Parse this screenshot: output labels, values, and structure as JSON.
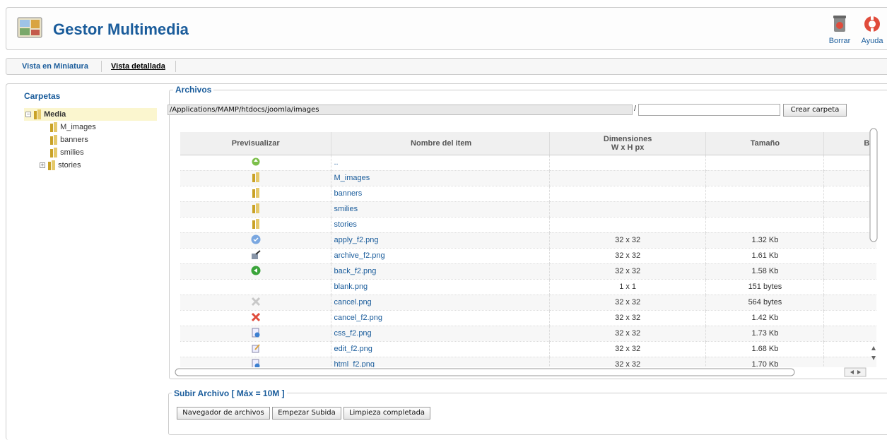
{
  "header": {
    "title": "Gestor Multimedia",
    "logo_icon": "media-manager-icon",
    "buttons": [
      {
        "label": "Borrar",
        "icon": "trash-icon"
      },
      {
        "label": "Ayuda",
        "icon": "help-lifebuoy-icon"
      }
    ]
  },
  "tabs": [
    {
      "label": "Vista en Miniatura",
      "active": false
    },
    {
      "label": "Vista detallada",
      "active": true
    }
  ],
  "sidebar": {
    "title": "Carpetas",
    "root": "Media",
    "items": [
      "M_images",
      "banners",
      "smilies",
      "stories"
    ]
  },
  "files": {
    "legend": "Archivos",
    "path": "/Applications/MAMP/htdocs/joomla/images",
    "separator": "/",
    "folder_input": "",
    "create_folder_label": "Crear carpeta",
    "columns": {
      "preview": "Previsualizar",
      "name": "Nombre del item",
      "dimensions": "Dimensiones",
      "dimensions_sub": "W x H px",
      "size": "Tamaño",
      "delete": "Borrar"
    },
    "rows": [
      {
        "icon": "folder-up-icon",
        "name": "..",
        "dim": "",
        "size": "",
        "del": false
      },
      {
        "icon": "folder-icon",
        "name": "M_images",
        "dim": "",
        "size": "",
        "del": true
      },
      {
        "icon": "folder-icon",
        "name": "banners",
        "dim": "",
        "size": "",
        "del": true
      },
      {
        "icon": "folder-icon",
        "name": "smilies",
        "dim": "",
        "size": "",
        "del": true
      },
      {
        "icon": "folder-icon",
        "name": "stories",
        "dim": "",
        "size": "",
        "del": true
      },
      {
        "icon": "apply-icon",
        "name": "apply_f2.png",
        "dim": "32 x 32",
        "size": "1.32 Kb",
        "del": true
      },
      {
        "icon": "archive-icon",
        "name": "archive_f2.png",
        "dim": "32 x 32",
        "size": "1.61 Kb",
        "del": true
      },
      {
        "icon": "back-icon",
        "name": "back_f2.png",
        "dim": "32 x 32",
        "size": "1.58 Kb",
        "del": true
      },
      {
        "icon": "blank-icon",
        "name": "blank.png",
        "dim": "1 x 1",
        "size": "151 bytes",
        "del": true
      },
      {
        "icon": "cancel-gray-icon",
        "name": "cancel.png",
        "dim": "32 x 32",
        "size": "564 bytes",
        "del": true
      },
      {
        "icon": "cancel-icon",
        "name": "cancel_f2.png",
        "dim": "32 x 32",
        "size": "1.42 Kb",
        "del": true
      },
      {
        "icon": "css-icon",
        "name": "css_f2.png",
        "dim": "32 x 32",
        "size": "1.73 Kb",
        "del": true
      },
      {
        "icon": "edit-icon",
        "name": "edit_f2.png",
        "dim": "32 x 32",
        "size": "1.68 Kb",
        "del": true
      },
      {
        "icon": "html-icon",
        "name": "html_f2.png",
        "dim": "32 x 32",
        "size": "1.70 Kb",
        "del": true
      }
    ]
  },
  "upload": {
    "legend": "Subir Archivo [ Máx = 10M ]",
    "buttons": [
      "Navegador de archivos",
      "Empezar Subida",
      "Limpieza completada"
    ]
  },
  "colors": {
    "accent": "#1a5c9b",
    "delete": "#e04b3b",
    "tree_highlight": "#fbf6cf"
  }
}
